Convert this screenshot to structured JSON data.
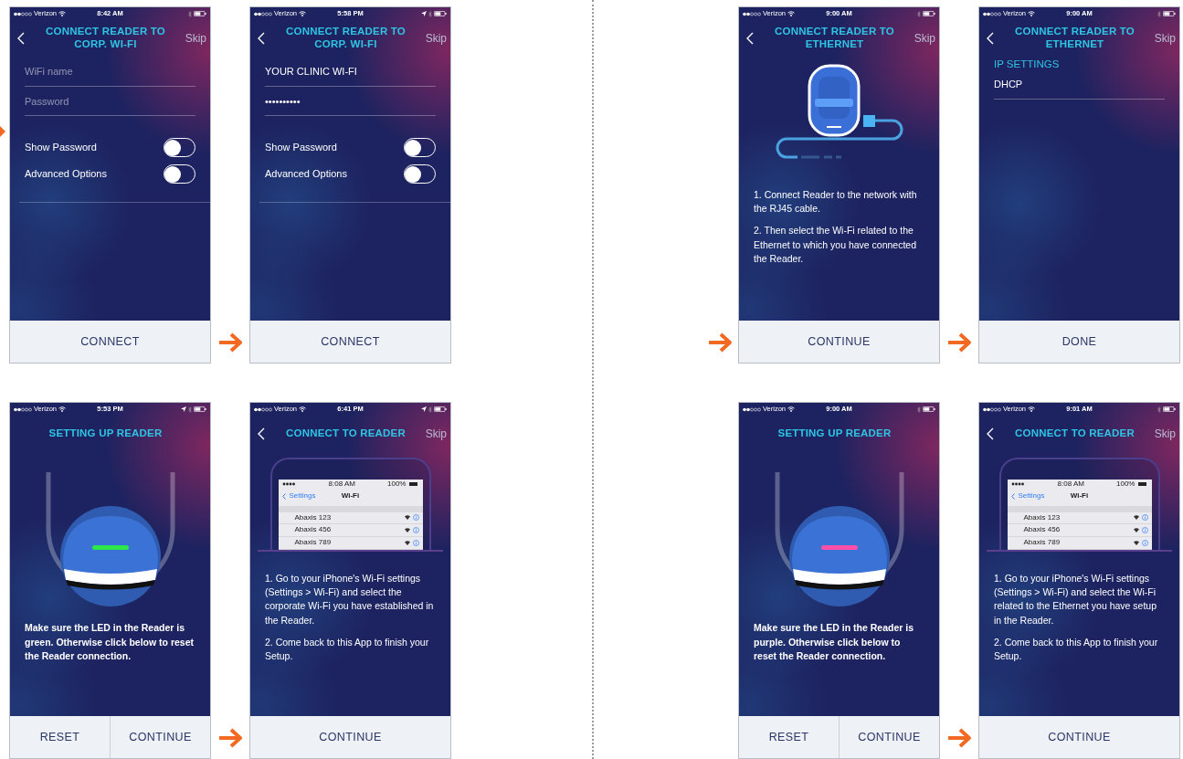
{
  "flows": [
    {
      "rows": [
        {
          "screens": [
            {
              "arrow_in": true,
              "arrow_cut": true,
              "status": {
                "carrier": "Verizon",
                "time": "8:42 AM",
                "location": false
              },
              "back": true,
              "title": "CONNECT READER TO CORP. WI-FI",
              "skip": "Skip",
              "kind": "form",
              "fields": [
                {
                  "placeholder": "WiFi name"
                },
                {
                  "placeholder": "Password"
                }
              ],
              "toggles": [
                {
                  "label": "Show Password",
                  "on": false
                },
                {
                  "label": "Advanced Options",
                  "on": false
                }
              ],
              "buttons": [
                "CONNECT"
              ]
            },
            {
              "arrow_in": true,
              "arrow_cut": false,
              "status": {
                "carrier": "Verizon",
                "time": "5:58 PM",
                "location": true
              },
              "back": true,
              "title": "CONNECT READER TO CORP. WI-FI",
              "skip": "Skip",
              "kind": "form",
              "fields": [
                {
                  "value": "YOUR CLINIC WI-FI"
                },
                {
                  "value": "••••••••••"
                }
              ],
              "toggles": [
                {
                  "label": "Show Password",
                  "on": false
                },
                {
                  "label": "Advanced Options",
                  "on": false
                }
              ],
              "buttons": [
                "CONNECT"
              ]
            }
          ]
        },
        {
          "screens": [
            {
              "arrow_in": false,
              "status": {
                "carrier": "Verizon",
                "time": "5:53 PM",
                "location": true
              },
              "back": false,
              "title": "SETTING UP READER",
              "kind": "setup",
              "color": "#2ee84a",
              "message": "Make sure the LED in the Reader is green. Otherwise click below to reset the Reader connection.",
              "buttons": [
                "RESET",
                "CONTINUE"
              ]
            },
            {
              "arrow_in": true,
              "arrow_cut": false,
              "status": {
                "carrier": "Verizon",
                "time": "6:41 PM",
                "location": true
              },
              "back": true,
              "title": "CONNECT TO READER",
              "skip": "Skip",
              "kind": "wifi-guide",
              "mockup": {
                "time": "8:08 AM",
                "battery": "100%",
                "back": "Settings",
                "title": "Wi-Fi",
                "networks": [
                  "Abaxis 123",
                  "Abaxis 456",
                  "Abaxis 789"
                ]
              },
              "instructions": [
                "1. Go to your iPhone's Wi-Fi settings (Settings > Wi-Fi) and select the corporate Wi-Fi you have established in the Reader.",
                "2. Come back to this App to finish your Setup."
              ],
              "buttons": [
                "CONTINUE"
              ]
            }
          ]
        }
      ]
    },
    {
      "rows": [
        {
          "screens": [
            {
              "arrow_in": true,
              "arrow_cut": false,
              "status": {
                "carrier": "Verizon",
                "time": "9:00 AM",
                "location": false
              },
              "back": true,
              "title": "CONNECT READER TO ETHERNET",
              "skip": "Skip",
              "kind": "ethernet",
              "instructions": [
                "1. Connect Reader to the network with the RJ45 cable.",
                "2. Then select the Wi-Fi related to the Ethernet to which you have connected the Reader."
              ],
              "buttons": [
                "CONTINUE"
              ]
            },
            {
              "arrow_in": true,
              "arrow_cut": false,
              "status": {
                "carrier": "Verizon",
                "time": "9:00 AM",
                "location": false
              },
              "back": true,
              "title": "CONNECT READER TO ETHERNET",
              "skip": "Skip",
              "kind": "ip",
              "section_label": "IP SETTINGS",
              "value": "DHCP",
              "buttons": [
                "DONE"
              ]
            }
          ]
        },
        {
          "screens": [
            {
              "arrow_in": false,
              "status": {
                "carrier": "Verizon",
                "time": "9:00 AM",
                "location": false
              },
              "back": false,
              "title": "SETTING UP READER",
              "kind": "setup",
              "color": "#ff4fa8",
              "message": "Make sure the LED in the Reader is purple. Otherwise click below to reset the Reader connection.",
              "buttons": [
                "RESET",
                "CONTINUE"
              ]
            },
            {
              "arrow_in": true,
              "arrow_cut": false,
              "status": {
                "carrier": "Verizon",
                "time": "9:01 AM",
                "location": false
              },
              "back": true,
              "title": "CONNECT TO READER",
              "skip": "Skip",
              "kind": "wifi-guide",
              "mockup": {
                "time": "8:08 AM",
                "battery": "100%",
                "back": "Settings",
                "title": "Wi-Fi",
                "networks": [
                  "Abaxis 123",
                  "Abaxis 456",
                  "Abaxis 789"
                ]
              },
              "instructions": [
                "1. Go to your iPhone's Wi-Fi settings (Settings > Wi-Fi) and select the Wi-Fi related to the Ethernet you have setup in the Reader.",
                "2. Come back to this App to finish your Setup."
              ],
              "buttons": [
                "CONTINUE"
              ]
            }
          ]
        }
      ]
    }
  ]
}
